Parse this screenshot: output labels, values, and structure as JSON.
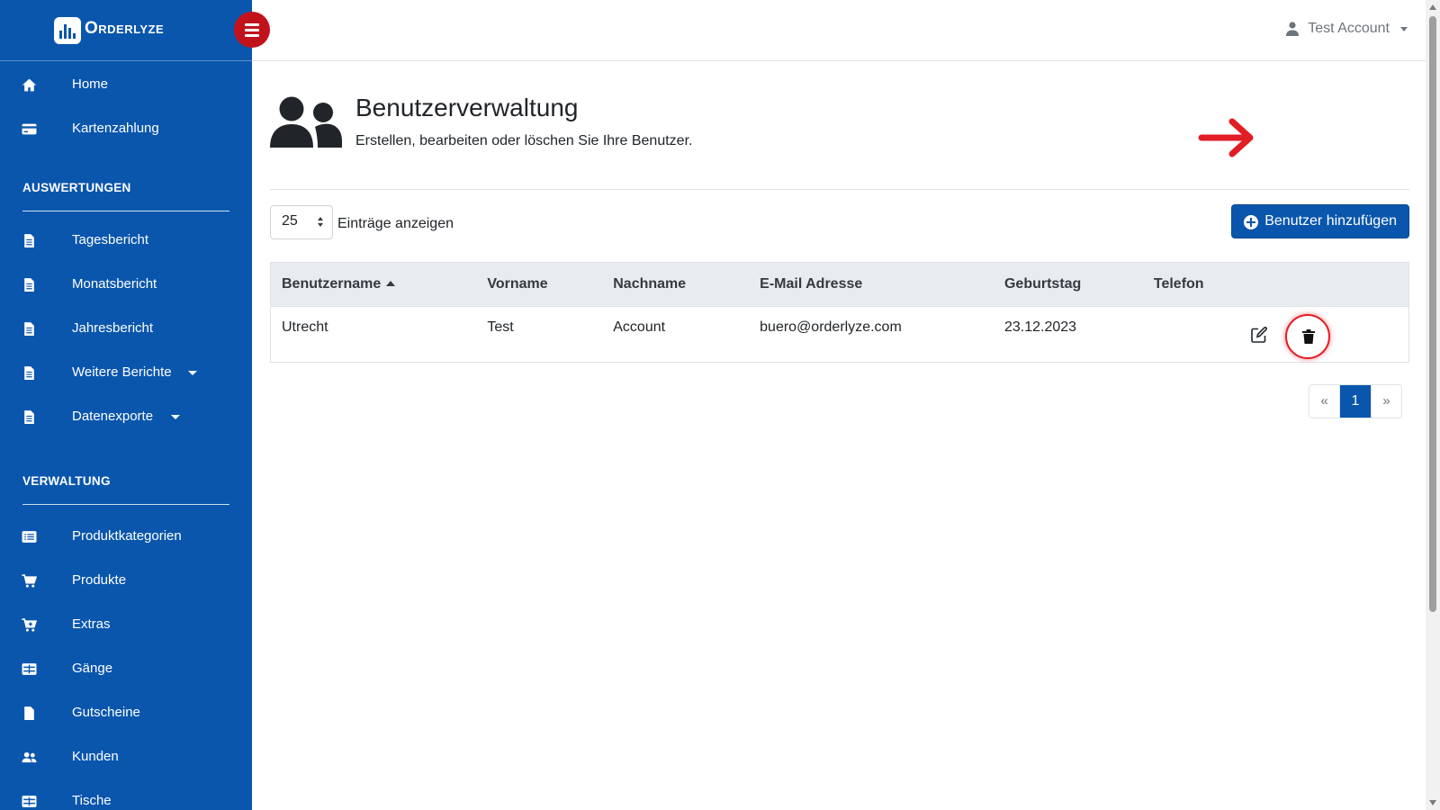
{
  "brand": {
    "name": "Orderlyze",
    "logo_icon": "bar-chart-logo-icon"
  },
  "topbar": {
    "account_name": "Test Account",
    "account_icon": "user-icon"
  },
  "sidebar": {
    "top_items": [
      {
        "label": "Home",
        "icon": "home-icon"
      },
      {
        "label": "Kartenzahlung",
        "icon": "credit-card-icon"
      }
    ],
    "sections": [
      {
        "title": "AUSWERTUNGEN",
        "items": [
          {
            "label": "Tagesbericht",
            "icon": "file-icon"
          },
          {
            "label": "Monatsbericht",
            "icon": "file-icon"
          },
          {
            "label": "Jahresbericht",
            "icon": "file-icon"
          },
          {
            "label": "Weitere Berichte",
            "icon": "file-icon",
            "has_dropdown": true
          },
          {
            "label": "Datenexporte",
            "icon": "file-icon",
            "has_dropdown": true
          }
        ]
      },
      {
        "title": "VERWALTUNG",
        "items": [
          {
            "label": "Produktkategorien",
            "icon": "list-icon"
          },
          {
            "label": "Produkte",
            "icon": "cart-icon"
          },
          {
            "label": "Extras",
            "icon": "cart-plus-icon"
          },
          {
            "label": "Gänge",
            "icon": "table-icon"
          },
          {
            "label": "Gutscheine",
            "icon": "file-icon"
          },
          {
            "label": "Kunden",
            "icon": "users-icon"
          },
          {
            "label": "Tische",
            "icon": "table-icon"
          }
        ]
      }
    ]
  },
  "page": {
    "icon": "users-icon",
    "title": "Benutzerverwaltung",
    "subtitle": "Erstellen, bearbeiten oder löschen Sie Ihre Benutzer."
  },
  "table_controls": {
    "page_length": "25",
    "page_length_label": "Einträge anzeigen",
    "add_button_label": "Benutzer hinzufügen"
  },
  "table": {
    "columns": [
      "Benutzername",
      "Vorname",
      "Nachname",
      "E-Mail Adresse",
      "Geburtstag",
      "Telefon"
    ],
    "sorted_column": "Benutzername",
    "sort_direction": "asc",
    "rows": [
      {
        "username": "Utrecht",
        "first_name": "Test",
        "last_name": "Account",
        "email": "buero@orderlyze.com",
        "birthday": "23.12.2023",
        "phone": ""
      }
    ]
  },
  "pagination": {
    "prev": "«",
    "current": "1",
    "next": "»"
  },
  "colors": {
    "sidebar": "#0a56ad",
    "toggle": "#c2121c",
    "highlight": "#e11d25",
    "header_bg": "#e9ecef"
  }
}
